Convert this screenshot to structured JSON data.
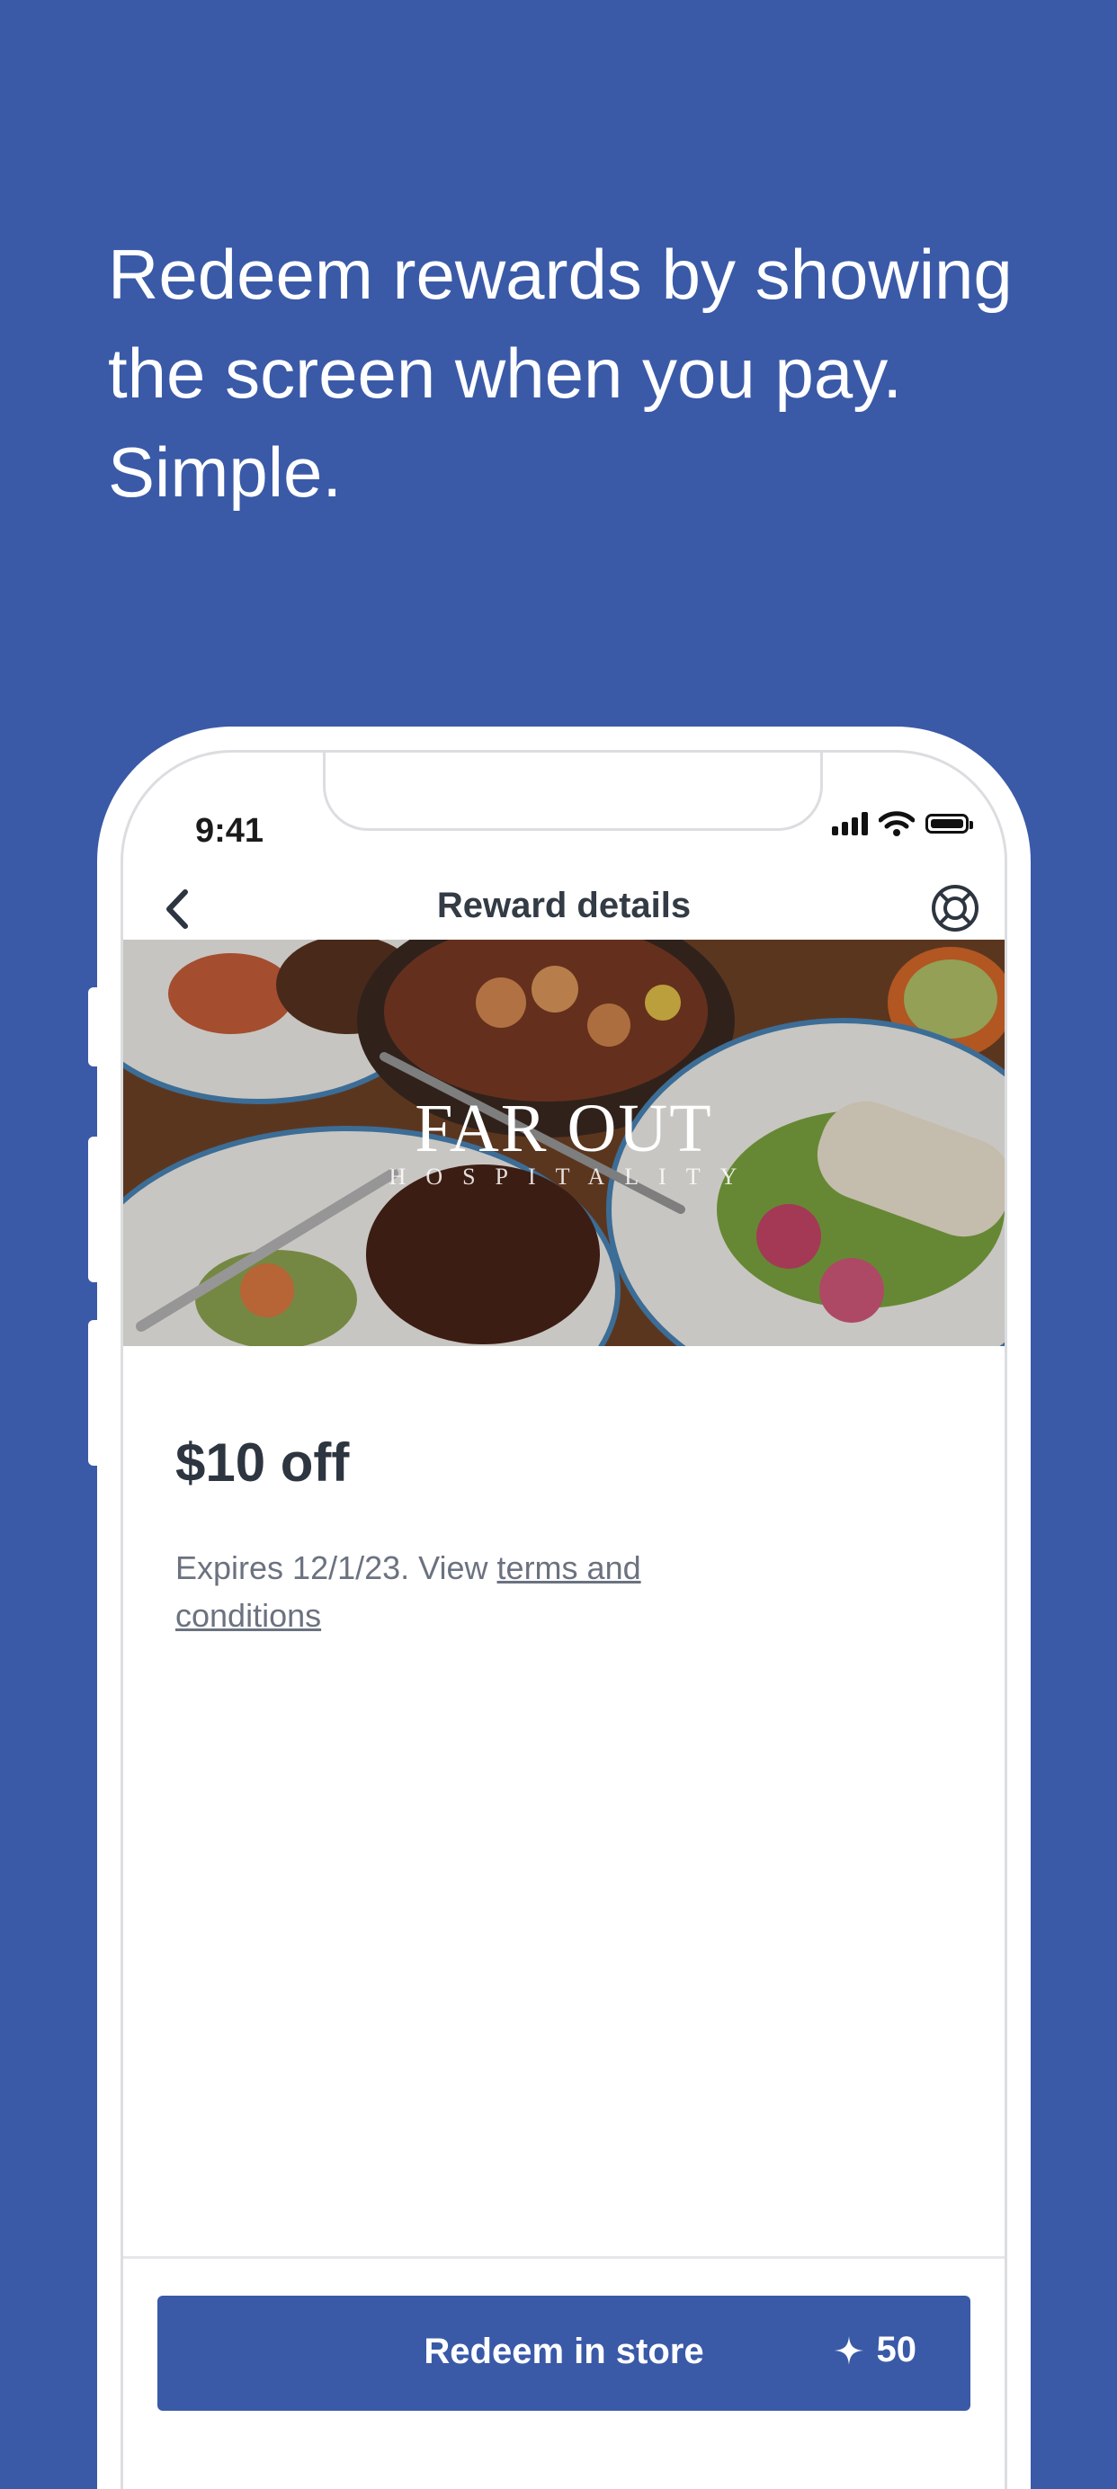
{
  "headline": {
    "lines": [
      "Redeem rewards by showing",
      "the screen when you pay.",
      "Simple."
    ]
  },
  "status_bar": {
    "time": "9:41"
  },
  "nav": {
    "title": "Reward details",
    "back_icon": "chevron-left-icon",
    "help_icon": "lifebuoy-icon"
  },
  "hero": {
    "logo_main": "FAR OUT",
    "logo_sub": "HOSPITALITY"
  },
  "reward": {
    "title": "$10 off",
    "expires_prefix": "Expires 12/1/23. View ",
    "terms_link": "terms and conditions"
  },
  "cta": {
    "label": "Redeem in store",
    "points": "50",
    "points_icon": "sparkle-icon"
  },
  "colors": {
    "background": "#3a5aa8",
    "button": "#3a5aa8",
    "text_dark": "#2d3540",
    "text_muted": "#6b7280"
  }
}
